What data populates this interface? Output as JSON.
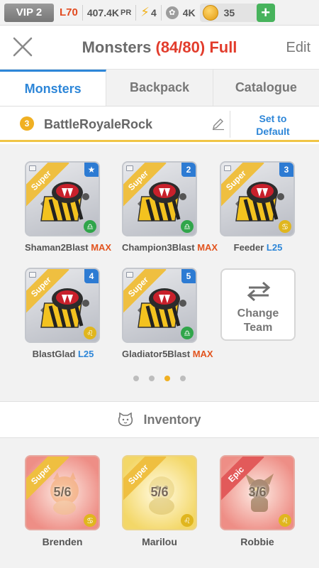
{
  "status_bar": {
    "vip": "VIP 2",
    "level": "L70",
    "power": "407.4K",
    "power_unit": "PR",
    "energy": "4",
    "food": "4K",
    "gold": "35",
    "add_label": "+"
  },
  "header": {
    "title": "Monsters",
    "count": "(84/80) Full",
    "edit_label": "Edit"
  },
  "tabs": [
    "Monsters",
    "Backpack",
    "Catalogue"
  ],
  "team": {
    "number": "3",
    "name": "BattleRoyaleRock",
    "set_default_line1": "Set to",
    "set_default_line2": "Default"
  },
  "team_monsters": [
    {
      "badge": "★",
      "rarity": "Super",
      "name": "Shaman2Blast",
      "level": "MAX",
      "element": "♎"
    },
    {
      "badge": "2",
      "rarity": "Super",
      "name": "Champion3Blast",
      "level": "MAX",
      "element": "♎"
    },
    {
      "badge": "3",
      "rarity": "Super",
      "name": "Feeder",
      "level": "L25",
      "element": "♋"
    },
    {
      "badge": "4",
      "rarity": "Super",
      "name": "BlastGlad",
      "level": "L25",
      "element": "♌"
    },
    {
      "badge": "5",
      "rarity": "Super",
      "name": "Gladiator5Blast",
      "level": "MAX",
      "element": "♎"
    }
  ],
  "change_team": {
    "line1": "Change",
    "line2": "Team"
  },
  "inventory": {
    "title": "Inventory",
    "items": [
      {
        "rarity": "Super",
        "fraction": "5/6",
        "name": "Brenden",
        "element": "♋"
      },
      {
        "rarity": "Super",
        "fraction": "5/6",
        "name": "Marilou",
        "element": "♌"
      },
      {
        "rarity": "Epic",
        "fraction": "3/6",
        "name": "Robbie",
        "element": "♌"
      }
    ]
  },
  "colors": {
    "accent_blue": "#2d86d8",
    "title_red": "#e23c2c",
    "max_orange": "#e2541f",
    "gold": "#f0b022"
  }
}
